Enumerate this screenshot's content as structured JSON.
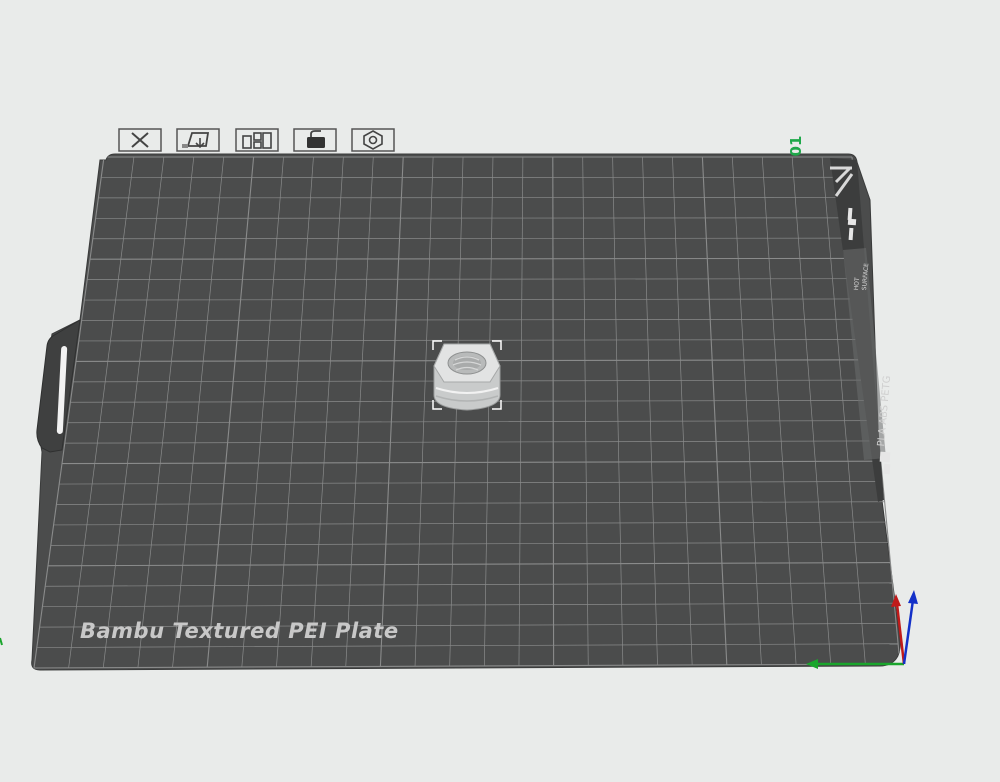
{
  "plate": {
    "name": "Bambu Textured PEI Plate",
    "index": "01",
    "side_label_materials": "PLA ABS PETG",
    "side_label_hot_1": "HOT",
    "side_label_hot_2": "SURFACE"
  },
  "plate_toolbar": [
    {
      "name": "remove-plate-icon",
      "tooltip": ""
    },
    {
      "name": "auto-orient-icon",
      "tooltip": ""
    },
    {
      "name": "arrange-icon",
      "tooltip": ""
    },
    {
      "name": "lock-plate-icon",
      "tooltip": ""
    },
    {
      "name": "plate-settings-icon",
      "tooltip": ""
    }
  ],
  "colors": {
    "background": "#e9ebea",
    "plate": "#4b4c4c",
    "grid": "#8a8b8b",
    "plate_index": "#1fa84a",
    "axis_x": "#1aa52c",
    "axis_y": "#c01a1a",
    "axis_z": "#1330c8"
  },
  "object": {
    "name": "hex-nut"
  }
}
